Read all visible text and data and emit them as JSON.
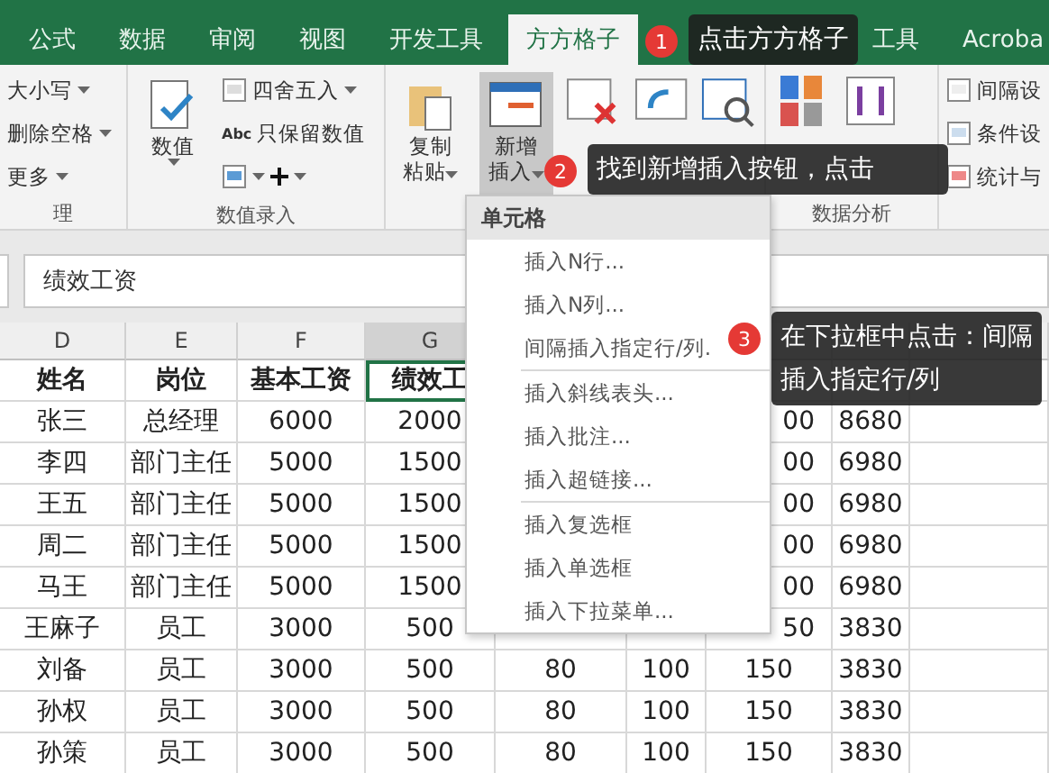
{
  "ribbon": {
    "tabs": [
      {
        "label": "公式",
        "selected": false
      },
      {
        "label": "数据",
        "selected": false
      },
      {
        "label": "审阅",
        "selected": false
      },
      {
        "label": "视图",
        "selected": false
      },
      {
        "label": "开发工具",
        "selected": false
      },
      {
        "label": "方方格子",
        "selected": true
      },
      {
        "label": "工具",
        "selected": false
      },
      {
        "label": "Acroba",
        "selected": false
      }
    ],
    "text_group": {
      "label": "理",
      "items": [
        "大小写",
        "删除空格",
        "更多"
      ]
    },
    "number_group": {
      "label": "数值录入",
      "big": "数值",
      "small": [
        "四舍五入",
        "只保留数值"
      ],
      "abc": "Abc"
    },
    "cell_group": {
      "buttons": [
        {
          "label": "复制粘贴",
          "pressed": false
        },
        {
          "label": "新增插入",
          "pressed": true
        }
      ]
    },
    "analysis_group": {
      "label": "数据分析"
    },
    "side_group": {
      "items": [
        "间隔设",
        "条件设",
        "统计与"
      ]
    }
  },
  "formula_bar": {
    "value": "绩效工资"
  },
  "table": {
    "columns": [
      {
        "label": "D",
        "selected": false
      },
      {
        "label": "E",
        "selected": false
      },
      {
        "label": "F",
        "selected": false
      },
      {
        "label": "G",
        "selected": true
      }
    ],
    "header": [
      {
        "text": "姓名",
        "selected": false
      },
      {
        "text": "岗位",
        "selected": false
      },
      {
        "text": "基本工资",
        "selected": false
      },
      {
        "text": "绩效工",
        "selected": true
      }
    ],
    "rows": [
      [
        "张三",
        "总经理",
        "6000",
        "2000",
        null,
        null,
        "00",
        "8680",
        null
      ],
      [
        "李四",
        "部门主任",
        "5000",
        "1500",
        null,
        null,
        "00",
        "6980",
        null
      ],
      [
        "王五",
        "部门主任",
        "5000",
        "1500",
        null,
        null,
        "00",
        "6980",
        null
      ],
      [
        "周二",
        "部门主任",
        "5000",
        "1500",
        null,
        null,
        "00",
        "6980",
        null
      ],
      [
        "马王",
        "部门主任",
        "5000",
        "1500",
        null,
        null,
        "00",
        "6980",
        null
      ],
      [
        "王麻子",
        "员工",
        "3000",
        "500",
        null,
        null,
        "50",
        "3830",
        null
      ],
      [
        "刘备",
        "员工",
        "3000",
        "500",
        "80",
        "100",
        "150",
        "3830",
        null
      ],
      [
        "孙权",
        "员工",
        "3000",
        "500",
        "80",
        "100",
        "150",
        "3830",
        null
      ],
      [
        "孙策",
        "员工",
        "3000",
        "500",
        "80",
        "100",
        "150",
        "3830",
        null
      ]
    ]
  },
  "dropdown": {
    "header": "单元格",
    "sections": [
      [
        "插入N行...",
        "插入N列...",
        "间隔插入指定行/列."
      ],
      [
        "插入斜线表头...",
        "插入批注...",
        "插入超链接..."
      ],
      [
        "插入复选框",
        "插入单选框",
        "插入下拉菜单..."
      ]
    ]
  },
  "callouts": [
    {
      "number": "1",
      "text": "点击方方格子"
    },
    {
      "number": "2",
      "text": "找到新增插入按钮，点击"
    },
    {
      "number": "3",
      "text": "在下拉框中点击：间隔插入指定行/列"
    }
  ]
}
